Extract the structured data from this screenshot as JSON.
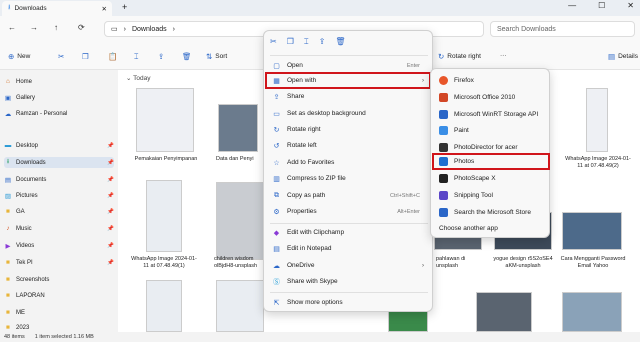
{
  "window": {
    "tab_title": "Downloads",
    "tab_close": "✕",
    "new_tab": "+",
    "minimize": "—",
    "maximize": "☐",
    "close": "✕"
  },
  "address": {
    "location": "Downloads",
    "search_placeholder": "Search Downloads"
  },
  "commandbar": {
    "new_label": "New",
    "sort_label": "Sort",
    "rotate_right_label": "Rotate right",
    "more_label": "···",
    "details_label": "Details"
  },
  "sidebar": {
    "items": [
      {
        "label": "Home",
        "icon": "home-icon"
      },
      {
        "label": "Gallery",
        "icon": "gallery-icon"
      },
      {
        "label": "Ramzan - Personal",
        "icon": "cloud-icon"
      },
      {
        "label": "Desktop",
        "icon": "desktop-icon"
      },
      {
        "label": "Downloads",
        "icon": "download-icon"
      },
      {
        "label": "Documents",
        "icon": "documents-icon"
      },
      {
        "label": "Pictures",
        "icon": "pictures-icon"
      },
      {
        "label": "GA",
        "icon": "folder-icon"
      },
      {
        "label": "Music",
        "icon": "music-icon"
      },
      {
        "label": "Videos",
        "icon": "videos-icon"
      },
      {
        "label": "Tek PI",
        "icon": "folder-icon"
      },
      {
        "label": "Screenshots",
        "icon": "folder-icon"
      },
      {
        "label": "LAPORAN",
        "icon": "folder-icon"
      },
      {
        "label": "ME",
        "icon": "folder-icon"
      },
      {
        "label": "2023",
        "icon": "folder-icon"
      }
    ]
  },
  "content": {
    "group_label": "Today",
    "files": [
      {
        "caption": "Pemakaian Penyimpanan"
      },
      {
        "caption": "Data dan Penyi"
      },
      {
        "caption": "WhatsApp Image 2024-01-11 at 07.48.49(2)"
      },
      {
        "caption": "children wisdom olBjdH8-unsplash"
      },
      {
        "caption": "WhatsApp Image 2024-01-11 at 07.48.49(1)"
      },
      {
        "caption": "pahlawan di unsplash"
      },
      {
        "caption": "yogue design r5S2oSE4 aKM-unsplash"
      },
      {
        "caption": "Cara Mengganti Password Email Yahoo"
      }
    ]
  },
  "context_menu": {
    "items": [
      {
        "label": "Open",
        "shortcut": "Enter"
      },
      {
        "label": "Open with",
        "has_sub": true
      },
      {
        "label": "Share"
      },
      {
        "label": "Set as desktop background"
      },
      {
        "label": "Rotate right"
      },
      {
        "label": "Rotate left"
      },
      {
        "label": "Add to Favorites"
      },
      {
        "label": "Compress to ZIP file"
      },
      {
        "label": "Copy as path",
        "shortcut": "Ctrl+Shift+C"
      },
      {
        "label": "Properties",
        "shortcut": "Alt+Enter"
      },
      {
        "label": "Edit with Clipchamp"
      },
      {
        "label": "Edit in Notepad"
      },
      {
        "label": "OneDrive",
        "has_sub": true
      },
      {
        "label": "Share with Skype"
      },
      {
        "label": "Show more options"
      }
    ]
  },
  "submenu": {
    "items": [
      {
        "label": "Firefox",
        "color": "#e8562a"
      },
      {
        "label": "Microsoft Office 2010",
        "color": "#d24726"
      },
      {
        "label": "Microsoft WinRT Storage API",
        "color": "#2a66c8"
      },
      {
        "label": "Paint",
        "color": "#3a8ee6"
      },
      {
        "label": "PhotoDirector for acer",
        "color": "#333333"
      },
      {
        "label": "Photos",
        "color": "#1f6fd1"
      },
      {
        "label": "PhotoScape X",
        "color": "#222222"
      },
      {
        "label": "Snipping Tool",
        "color": "#5b46c8"
      },
      {
        "label": "Search the Microsoft Store",
        "color": "#2a66c8"
      },
      {
        "label": "Choose another app",
        "color": ""
      }
    ]
  },
  "status": {
    "items_count": "48 items",
    "selected": "1 item selected 1.16 MB"
  }
}
